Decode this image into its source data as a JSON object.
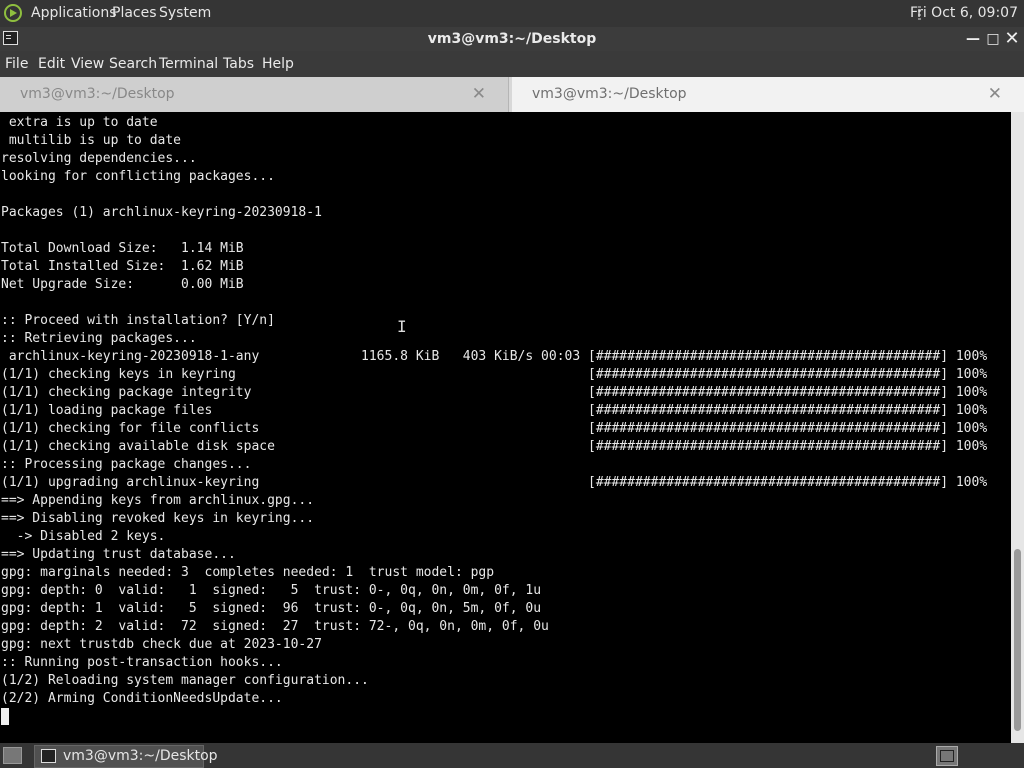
{
  "top_panel": {
    "menu": [
      "Applications",
      "Places",
      "System"
    ],
    "clock": "Fri Oct  6, 09:07"
  },
  "window": {
    "title": "vm3@vm3:~/Desktop",
    "min_label": "—",
    "max_label": "□",
    "close_label": "✕"
  },
  "menubar": [
    "File",
    "Edit",
    "View",
    "Search",
    "Terminal",
    "Tabs",
    "Help"
  ],
  "tabs": [
    {
      "label": "vm3@vm3:~/Desktop",
      "close": "✕",
      "active": false
    },
    {
      "label": "vm3@vm3:~/Desktop",
      "close": "✕",
      "active": true
    }
  ],
  "terminal": {
    "lines": [
      " extra is up to date",
      " multilib is up to date",
      "resolving dependencies...",
      "looking for conflicting packages...",
      "",
      "Packages (1) archlinux-keyring-20230918-1",
      "",
      "Total Download Size:   1.14 MiB",
      "Total Installed Size:  1.62 MiB",
      "Net Upgrade Size:      0.00 MiB",
      "",
      ":: Proceed with installation? [Y/n]",
      ":: Retrieving packages...",
      " archlinux-keyring-20230918-1-any             1165.8 KiB   403 KiB/s 00:03 [############################################] 100%",
      "(1/1) checking keys in keyring                                             [############################################] 100%",
      "(1/1) checking package integrity                                           [############################################] 100%",
      "(1/1) loading package files                                                [############################################] 100%",
      "(1/1) checking for file conflicts                                          [############################################] 100%",
      "(1/1) checking available disk space                                        [############################################] 100%",
      ":: Processing package changes...",
      "(1/1) upgrading archlinux-keyring                                          [############################################] 100%",
      "==> Appending keys from archlinux.gpg...",
      "==> Disabling revoked keys in keyring...",
      "  -> Disabled 2 keys.",
      "==> Updating trust database...",
      "gpg: marginals needed: 3  completes needed: 1  trust model: pgp",
      "gpg: depth: 0  valid:   1  signed:   5  trust: 0-, 0q, 0n, 0m, 0f, 1u",
      "gpg: depth: 1  valid:   5  signed:  96  trust: 0-, 0q, 0n, 5m, 0f, 0u",
      "gpg: depth: 2  valid:  72  signed:  27  trust: 72-, 0q, 0n, 0m, 0f, 0u",
      "gpg: next trustdb check due at 2023-10-27",
      ":: Running post-transaction hooks...",
      "(1/2) Reloading system manager configuration...",
      "(2/2) Arming ConditionNeedsUpdate..."
    ],
    "cursor_glyph": "I"
  },
  "taskbar": {
    "task_label": "vm3@vm3:~/Desktop"
  }
}
